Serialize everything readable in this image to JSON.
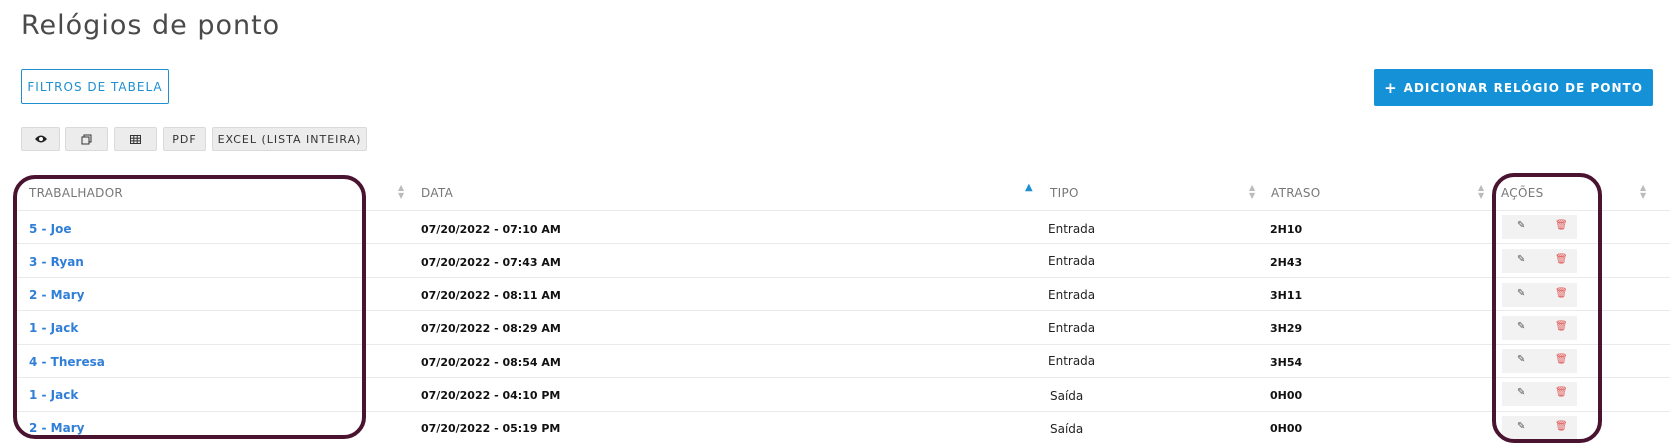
{
  "page": {
    "title": "Relógios de ponto"
  },
  "toolbar": {
    "filters_label": "FILTROS DE TABELA",
    "add_label": "ADICIONAR RELÓGIO DE PONTO",
    "add_icon": "plus-icon",
    "export_buttons": [
      {
        "icon": "eye-icon"
      },
      {
        "icon": "copy-icon"
      },
      {
        "icon": "grid-icon"
      },
      {
        "label": "PDF"
      },
      {
        "label": "EXCEL (LISTA INTEIRA)"
      }
    ]
  },
  "table": {
    "columns": [
      "TRABALHADOR",
      "DATA",
      "TIPO",
      "ATRASO",
      "AÇÕES"
    ],
    "sorted_column": "DATA",
    "sort_direction": "asc",
    "rows": [
      {
        "worker": "5 - Joe",
        "date": "07/20/2022 - 07:10 AM",
        "type": "Entrada",
        "delay": "2H10"
      },
      {
        "worker": "3 - Ryan",
        "date": "07/20/2022 - 07:43 AM",
        "type": "Entrada",
        "delay": "2H43"
      },
      {
        "worker": "2 - Mary",
        "date": "07/20/2022 - 08:11 AM",
        "type": "Entrada",
        "delay": "3H11"
      },
      {
        "worker": "1 - Jack",
        "date": "07/20/2022 - 08:29 AM",
        "type": "Entrada",
        "delay": "3H29"
      },
      {
        "worker": "4 - Theresa",
        "date": "07/20/2022 - 08:54 AM",
        "type": "Entrada",
        "delay": "3H54"
      },
      {
        "worker": "1 - Jack",
        "date": "07/20/2022 - 04:10 PM",
        "type": "Saída",
        "delay": "0H00"
      },
      {
        "worker": "2 - Mary",
        "date": "07/20/2022 - 05:19 PM",
        "type": "Saída",
        "delay": "0H00"
      }
    ]
  },
  "colors": {
    "accent": "#1591d8",
    "link": "#2f7ed8",
    "delete": "#e05555",
    "highlight_frame": "#4a1330"
  }
}
